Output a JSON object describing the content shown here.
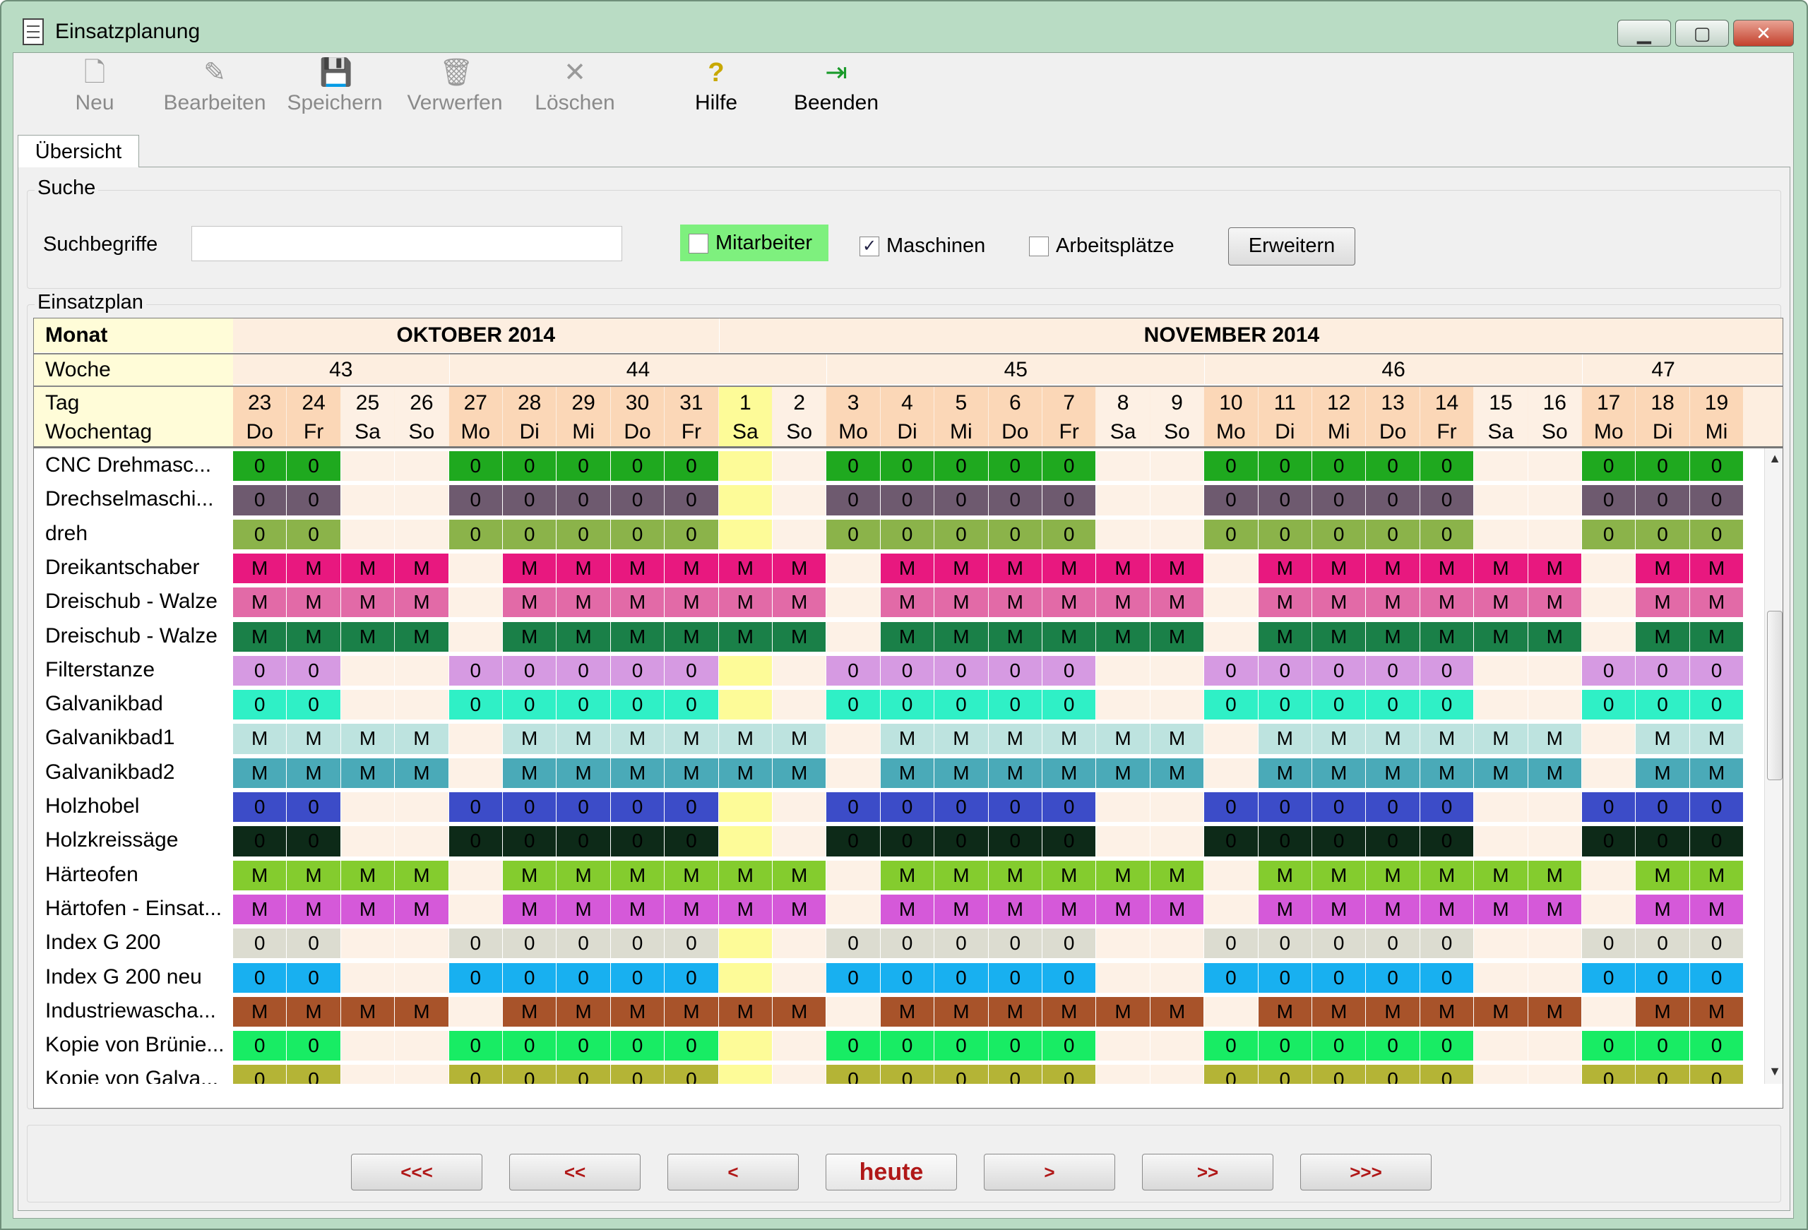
{
  "window": {
    "title": "Einsatzplanung"
  },
  "toolbar": [
    {
      "key": "neu",
      "label": "Neu",
      "icon": "new-document-icon",
      "enabled": false
    },
    {
      "key": "bearbeiten",
      "label": "Bearbeiten",
      "icon": "edit-icon",
      "enabled": false
    },
    {
      "key": "speichern",
      "label": "Speichern",
      "icon": "save-icon",
      "enabled": false
    },
    {
      "key": "verwerfen",
      "label": "Verwerfen",
      "icon": "trash-icon",
      "enabled": false
    },
    {
      "key": "loeschen",
      "label": "Löschen",
      "icon": "delete-x-icon",
      "enabled": false
    },
    {
      "key": "hilfe",
      "label": "Hilfe",
      "icon": "help-icon",
      "enabled": true
    },
    {
      "key": "beenden",
      "label": "Beenden",
      "icon": "exit-icon",
      "enabled": true
    }
  ],
  "tabs": [
    {
      "label": "Übersicht",
      "active": true
    }
  ],
  "search": {
    "group_title": "Suche",
    "label": "Suchbegriffe",
    "value": "",
    "placeholder": "",
    "checkboxes": [
      {
        "label": "Mitarbeiter",
        "checked": false,
        "highlight": "#7ef07e"
      },
      {
        "label": "Maschinen",
        "checked": true
      },
      {
        "label": "Arbeitsplätze",
        "checked": false
      }
    ],
    "button": "Erweitern"
  },
  "plan": {
    "group_title": "Einsatzplan",
    "header_labels": {
      "month": "Monat",
      "week": "Woche",
      "day": "Tag",
      "weekday": "Wochentag"
    },
    "months": [
      {
        "label": "OKTOBER 2014",
        "span": 9
      },
      {
        "label": "NOVEMBER 2014",
        "span": 19
      }
    ],
    "weeks": [
      {
        "label": "43",
        "span": 4
      },
      {
        "label": "44",
        "span": 7
      },
      {
        "label": "45",
        "span": 7
      },
      {
        "label": "46",
        "span": 7
      },
      {
        "label": "47",
        "span": 3
      }
    ],
    "days": [
      "23",
      "24",
      "25",
      "26",
      "27",
      "28",
      "29",
      "30",
      "31",
      "1",
      "2",
      "3",
      "4",
      "5",
      "6",
      "7",
      "8",
      "9",
      "10",
      "11",
      "12",
      "13",
      "14",
      "15",
      "16",
      "17",
      "18",
      "19"
    ],
    "weekdays": [
      "Do",
      "Fr",
      "Sa",
      "So",
      "Mo",
      "Di",
      "Mi",
      "Do",
      "Fr",
      "Sa",
      "So",
      "Mo",
      "Di",
      "Mi",
      "Do",
      "Fr",
      "Sa",
      "So",
      "Mo",
      "Di",
      "Mi",
      "Do",
      "Fr",
      "Sa",
      "So",
      "Mo",
      "Di",
      "Mi"
    ],
    "today_index": 9,
    "colors": {
      "label_bg": "#fffcd8",
      "header_bg": "#fdeee0",
      "day_bg": "#fbd7b7",
      "weekend_bg": "#fdf0e4",
      "today_bg": "#fdfb98",
      "empty_cell": "#fdf1e6"
    },
    "rows": [
      {
        "name": "CNC Drehmasc...",
        "schedule": "0-work",
        "color": "#1fa91f"
      },
      {
        "name": "Drechselmaschi...",
        "schedule": "0-work",
        "color": "#6e5a6f"
      },
      {
        "name": "dreh",
        "schedule": "0-work",
        "color": "#8bb34a"
      },
      {
        "name": "Dreikantschaber",
        "schedule": "M-except-mon",
        "color": "#e8187f"
      },
      {
        "name": "Dreischub - Walze",
        "schedule": "M-except-mon",
        "color": "#e26aa7"
      },
      {
        "name": "Dreischub - Walze",
        "schedule": "M-except-mon",
        "color": "#1a8048"
      },
      {
        "name": "Filterstanze",
        "schedule": "0-work",
        "color": "#d69ae2"
      },
      {
        "name": "Galvanikbad",
        "schedule": "0-work",
        "color": "#2ff0c6"
      },
      {
        "name": "Galvanikbad1",
        "schedule": "M-except-mon",
        "color": "#bde3df"
      },
      {
        "name": "Galvanikbad2",
        "schedule": "M-except-mon",
        "color": "#4aaab8"
      },
      {
        "name": "Holzhobel",
        "schedule": "0-work",
        "color": "#3c4cc8"
      },
      {
        "name": "Holzkreissäge",
        "schedule": "0-work",
        "color": "#0d2a18"
      },
      {
        "name": "Härteofen",
        "schedule": "M-except-mon",
        "color": "#84cc2e"
      },
      {
        "name": "Härtofen - Einsat...",
        "schedule": "M-except-mon",
        "color": "#d559d9"
      },
      {
        "name": "Index G 200",
        "schedule": "0-work",
        "color": "#dcdcd0"
      },
      {
        "name": "Index G 200 neu",
        "schedule": "0-work",
        "color": "#18b0f0"
      },
      {
        "name": "Industriewascha...",
        "schedule": "M-except-mon",
        "color": "#a8532a"
      },
      {
        "name": "Kopie von Brünie...",
        "schedule": "0-work",
        "color": "#18ec64"
      },
      {
        "name": "Kopie von Galva...",
        "schedule": "0-work",
        "color": "#b4b436"
      }
    ]
  },
  "navigation": [
    "<<<",
    "<<",
    "<",
    "heute",
    ">",
    ">>",
    ">>>"
  ]
}
